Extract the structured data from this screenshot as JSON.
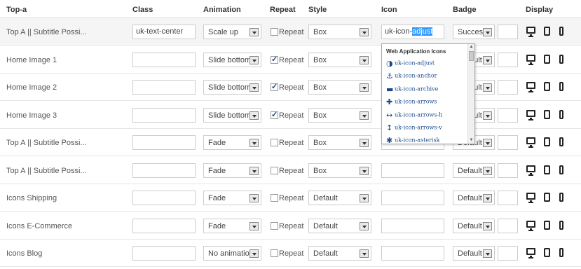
{
  "headers": {
    "name": "Top-a",
    "class": "Class",
    "animation": "Animation",
    "repeat": "Repeat",
    "style": "Style",
    "icon": "Icon",
    "badge": "Badge",
    "display": "Display"
  },
  "repeat_label": "Repeat",
  "rows": [
    {
      "name": "Top A || Subtitle Possi...",
      "class": "uk-text-center",
      "animation": "Scale up",
      "repeat": false,
      "style": "Box",
      "icon_prefix": "uk-icon-",
      "icon_highlight": "adjust",
      "badge": "Success"
    },
    {
      "name": "Home Image 1",
      "class": "",
      "animation": "Slide bottom",
      "repeat": true,
      "style": "Box",
      "icon_prefix": "",
      "icon_highlight": "",
      "badge": "Default"
    },
    {
      "name": "Home Image 2",
      "class": "",
      "animation": "Slide bottom",
      "repeat": true,
      "style": "Box",
      "icon_prefix": "",
      "icon_highlight": "",
      "badge": "Default"
    },
    {
      "name": "Home Image 3",
      "class": "",
      "animation": "Slide bottom",
      "repeat": true,
      "style": "Box",
      "icon_prefix": "",
      "icon_highlight": "",
      "badge": "Default"
    },
    {
      "name": "Top A || Subtitle Possi...",
      "class": "",
      "animation": "Fade",
      "repeat": false,
      "style": "Box",
      "icon_prefix": "",
      "icon_highlight": "",
      "badge": "Default"
    },
    {
      "name": "Top A || Subtitle Possi...",
      "class": "",
      "animation": "Fade",
      "repeat": false,
      "style": "Box",
      "icon_prefix": "",
      "icon_highlight": "",
      "badge": "Default"
    },
    {
      "name": "Icons Shipping",
      "class": "",
      "animation": "Fade",
      "repeat": false,
      "style": "Default",
      "icon_prefix": "",
      "icon_highlight": "",
      "badge": "Default"
    },
    {
      "name": "Icons E-Commerce",
      "class": "",
      "animation": "Fade",
      "repeat": false,
      "style": "Default",
      "icon_prefix": "",
      "icon_highlight": "",
      "badge": "Default"
    },
    {
      "name": "Icons Blog",
      "class": "",
      "animation": "No animation",
      "repeat": false,
      "style": "Default",
      "icon_prefix": "",
      "icon_highlight": "",
      "badge": "Default"
    }
  ],
  "icon_popup": {
    "title": "Web Application Icons",
    "items": [
      {
        "label": "uk-icon-adjust",
        "icon": "adjust-icon",
        "glyph": "◑"
      },
      {
        "label": "uk-icon-anchor",
        "icon": "anchor-icon",
        "glyph": "⚓"
      },
      {
        "label": "uk-icon-archive",
        "icon": "archive-icon",
        "glyph": "▬"
      },
      {
        "label": "uk-icon-arrows",
        "icon": "arrows-icon",
        "glyph": "✚"
      },
      {
        "label": "uk-icon-arrows-h",
        "icon": "arrows-h-icon",
        "glyph": "↔"
      },
      {
        "label": "uk-icon-arrows-v",
        "icon": "arrows-v-icon",
        "glyph": "↕"
      },
      {
        "label": "uk-icon-asterisk",
        "icon": "asterisk-icon",
        "glyph": "✱"
      }
    ]
  }
}
